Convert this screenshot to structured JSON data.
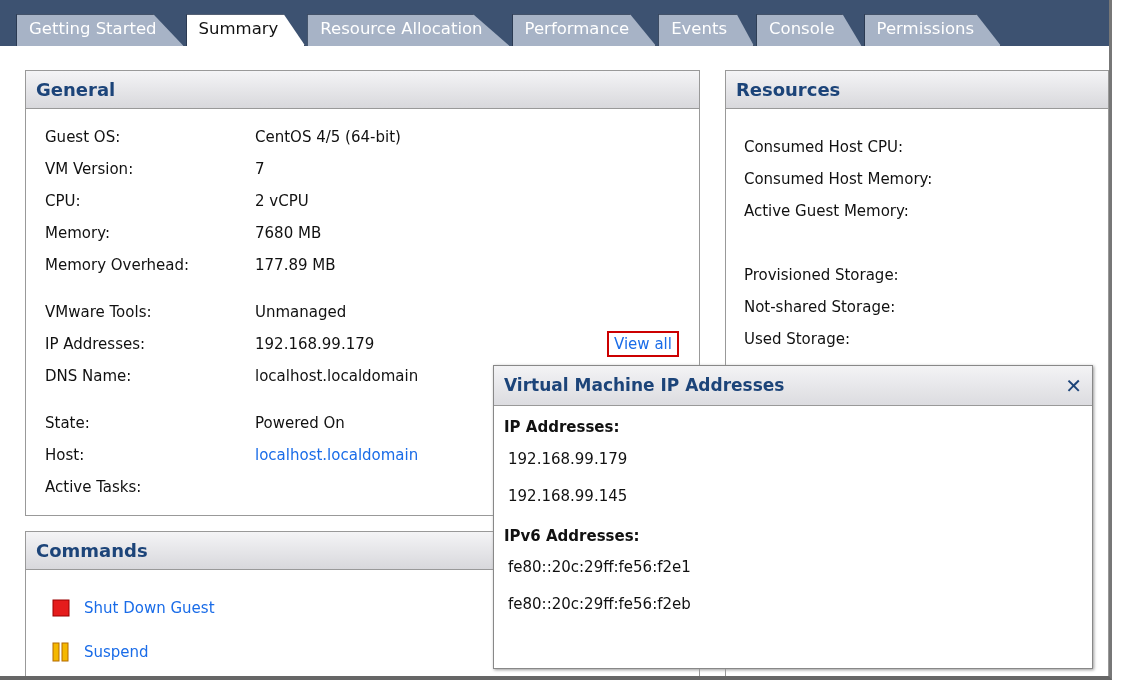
{
  "tabs": [
    {
      "label": "Getting Started",
      "selected": false
    },
    {
      "label": "Summary",
      "selected": true
    },
    {
      "label": "Resource Allocation",
      "selected": false
    },
    {
      "label": "Performance",
      "selected": false
    },
    {
      "label": "Events",
      "selected": false
    },
    {
      "label": "Console",
      "selected": false
    },
    {
      "label": "Permissions",
      "selected": false
    }
  ],
  "general": {
    "title": "General",
    "groups": [
      [
        {
          "label": "Guest OS:",
          "value": "CentOS 4/5 (64-bit)"
        },
        {
          "label": "VM Version:",
          "value": "7"
        },
        {
          "label": "CPU:",
          "value": "2 vCPU"
        },
        {
          "label": "Memory:",
          "value": "7680 MB"
        },
        {
          "label": "Memory Overhead:",
          "value": "177.89 MB"
        }
      ],
      [
        {
          "label": "VMware Tools:",
          "value": "Unmanaged"
        },
        {
          "label": "IP Addresses:",
          "value": "192.168.99.179",
          "action": "View all"
        },
        {
          "label": "DNS Name:",
          "value": "localhost.localdomain"
        }
      ],
      [
        {
          "label": "State:",
          "value": "Powered On"
        },
        {
          "label": "Host:",
          "value": "localhost.localdomain",
          "link": true
        },
        {
          "label": "Active Tasks:"
        }
      ]
    ]
  },
  "commands": {
    "title": "Commands",
    "items": [
      {
        "kind": "stop",
        "label": "Shut Down Guest"
      },
      {
        "kind": "pause",
        "label": "Suspend"
      }
    ]
  },
  "resources": {
    "title": "Resources",
    "groups": [
      [
        "Consumed Host CPU:",
        "Consumed Host Memory:",
        "Active Guest Memory:"
      ],
      [
        "Provisioned Storage:",
        "Not-shared Storage:",
        "Used Storage:"
      ]
    ]
  },
  "popup": {
    "title": "Virtual Machine IP Addresses",
    "close": "✕",
    "sections": [
      {
        "heading": "IP Addresses:",
        "items": [
          "192.168.99.179",
          "192.168.99.145"
        ]
      },
      {
        "heading": "IPv6 Addresses:",
        "items": [
          "fe80::20c:29ff:fe56:f2e1",
          "fe80::20c:29ff:fe56:f2eb"
        ]
      }
    ]
  }
}
